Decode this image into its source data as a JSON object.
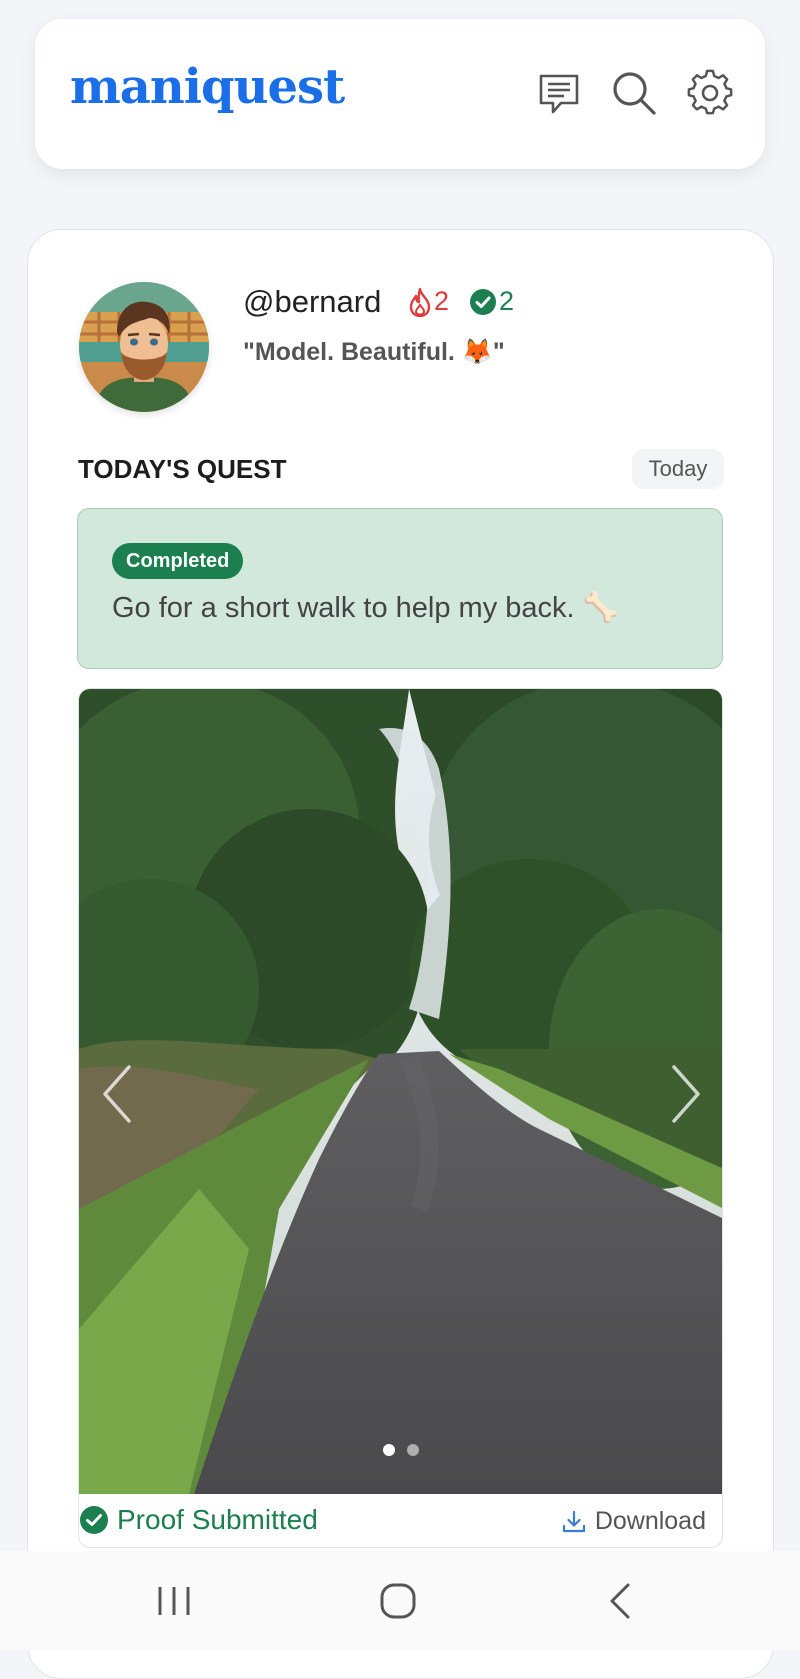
{
  "header": {
    "logo": "maniquest",
    "icons": [
      "chat-icon",
      "search-icon",
      "settings-gear-icon"
    ]
  },
  "profile": {
    "username": "@bernard",
    "streak_count": "2",
    "completed_count": "2",
    "bio": "\"Model. Beautiful. 🦊\""
  },
  "quest": {
    "section_title": "TODAY'S QUEST",
    "date_chip": "Today",
    "status_badge": "Completed",
    "text": "Go for a short walk to help my back. 🦴"
  },
  "proof": {
    "status_label": "Proof Submitted",
    "download_label": "Download",
    "carousel_total": 2,
    "carousel_active": 1
  },
  "colors": {
    "brand": "#1a6ee8",
    "success": "#1b7f4f",
    "streak": "#e03b3b",
    "quest_bg": "#d3e8dd"
  },
  "system_nav": [
    "recent-apps-icon",
    "home-icon",
    "back-icon"
  ]
}
